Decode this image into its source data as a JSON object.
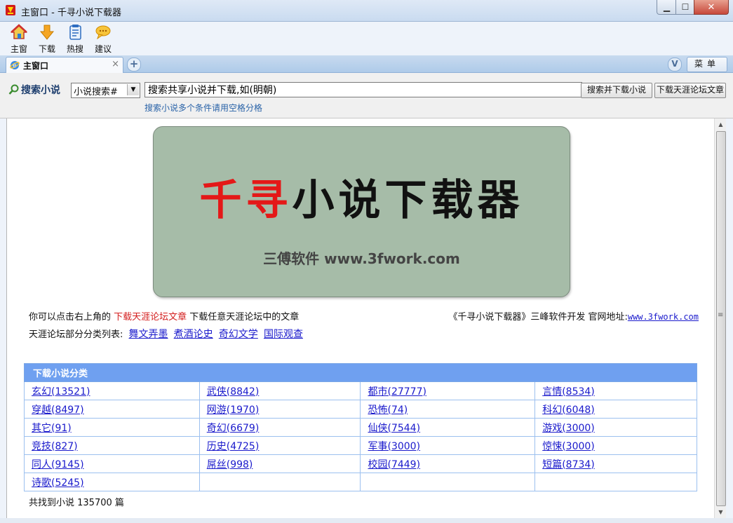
{
  "window": {
    "title": "主窗口 - 千寻小说下载器",
    "min_label": "▁",
    "max_label": "☐",
    "close_label": "✕"
  },
  "toolbar": {
    "items": [
      {
        "label": "主窗",
        "icon": "home-icon"
      },
      {
        "label": "下载",
        "icon": "download-arrow-icon"
      },
      {
        "label": "热搜",
        "icon": "notepad-icon"
      },
      {
        "label": "建议",
        "icon": "speech-bubble-icon"
      }
    ]
  },
  "tabs": {
    "active_label": "主窗口",
    "close_glyph": "×",
    "new_tab_glyph": "+",
    "v_glyph": "V",
    "menu_label": "菜单"
  },
  "search": {
    "label": "搜索小说",
    "mode_value": "小说搜索#",
    "input_value": "搜索共享小说并下载,如(明朝)",
    "hint": "搜索小说多个条件请用空格分格",
    "search_button": "搜索并下载小说",
    "forum_button": "下载天涯论坛文章"
  },
  "banner": {
    "title_red": "千寻",
    "title_black": "小说下载器",
    "subtitle": "三傅软件 www.3fwork.com"
  },
  "info": {
    "line1_prefix": "你可以点击右上角的 ",
    "line1_link": "下载天涯论坛文章",
    "line1_suffix": " 下载任意天涯论坛中的文章",
    "credit_text": "《千寻小说下载器》三峰软件开发 官网地址:",
    "credit_url": "www.3fwork.com",
    "forum_prefix": "天涯论坛部分分类列表:",
    "forum_links": [
      "舞文弄墨",
      "煮酒论史",
      "奇幻文学",
      "国际观查"
    ]
  },
  "categories": {
    "header": "下载小说分类",
    "rows": [
      [
        "玄幻(13521)",
        "武侠(8842)",
        "都市(27777)",
        "言情(8534)"
      ],
      [
        "穿越(8497)",
        "网游(1970)",
        "恐怖(74)",
        "科幻(6048)"
      ],
      [
        "其它(91)",
        "奇幻(6679)",
        "仙侠(7544)",
        "游戏(3000)"
      ],
      [
        "竞技(827)",
        "历史(4725)",
        "军事(3000)",
        "惊悚(3000)"
      ],
      [
        "同人(9145)",
        "屌丝(998)",
        "校园(7449)",
        "短篇(8734)"
      ],
      [
        "诗歌(5245)",
        "",
        "",
        ""
      ]
    ]
  },
  "footer": {
    "count_text": "共找到小说 135700 篇"
  },
  "colors": {
    "accent": "#6fa0f0",
    "banner_bg": "#a6bca8",
    "link": "#1a1acc",
    "red": "#e41818"
  }
}
